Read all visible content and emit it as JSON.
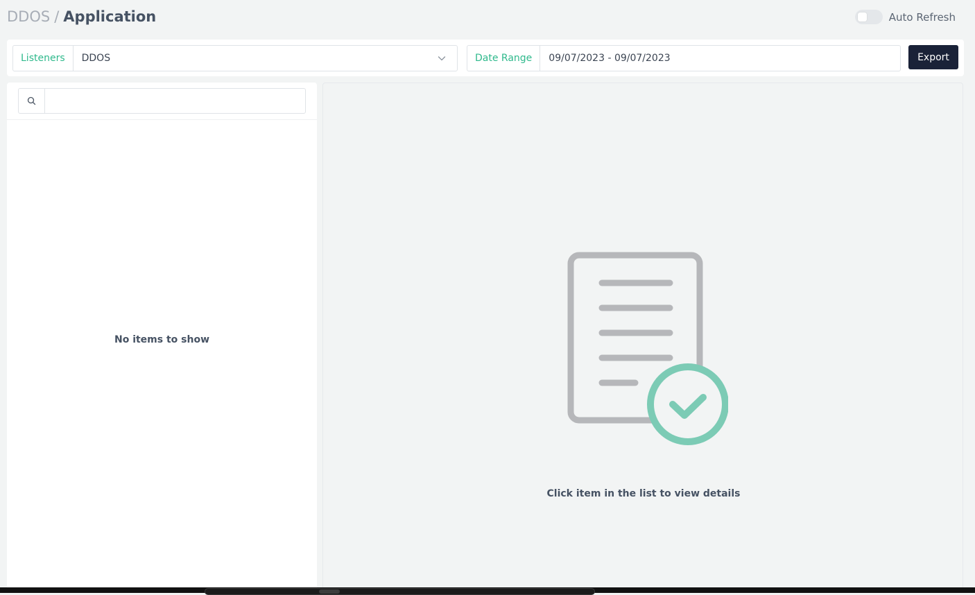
{
  "header": {
    "breadcrumb": {
      "parent": "DDOS",
      "separator": "/",
      "current": "Application"
    },
    "auto_refresh": {
      "label": "Auto Refresh",
      "enabled": false
    }
  },
  "filters": {
    "listeners": {
      "label": "Listeners",
      "value": "DDOS"
    },
    "date_range": {
      "label": "Date Range",
      "value": "09/07/2023 - 09/07/2023"
    },
    "export_label": "Export"
  },
  "list_panel": {
    "search": {
      "value": "",
      "placeholder": ""
    },
    "empty_message": "No items to show"
  },
  "detail_panel": {
    "hint": "Click item in the list to view details",
    "illustration_icon": "document-check-icon"
  },
  "colors": {
    "accent": "#2fb98c",
    "check_circle": "#7ccbb5",
    "document_stroke": "#b6b7ba",
    "button_bg": "#1a2238",
    "text_primary": "#465263",
    "text_muted": "#a7adb6"
  },
  "icons": {
    "search": "search-icon",
    "dropdown": "chevron-down-icon"
  }
}
